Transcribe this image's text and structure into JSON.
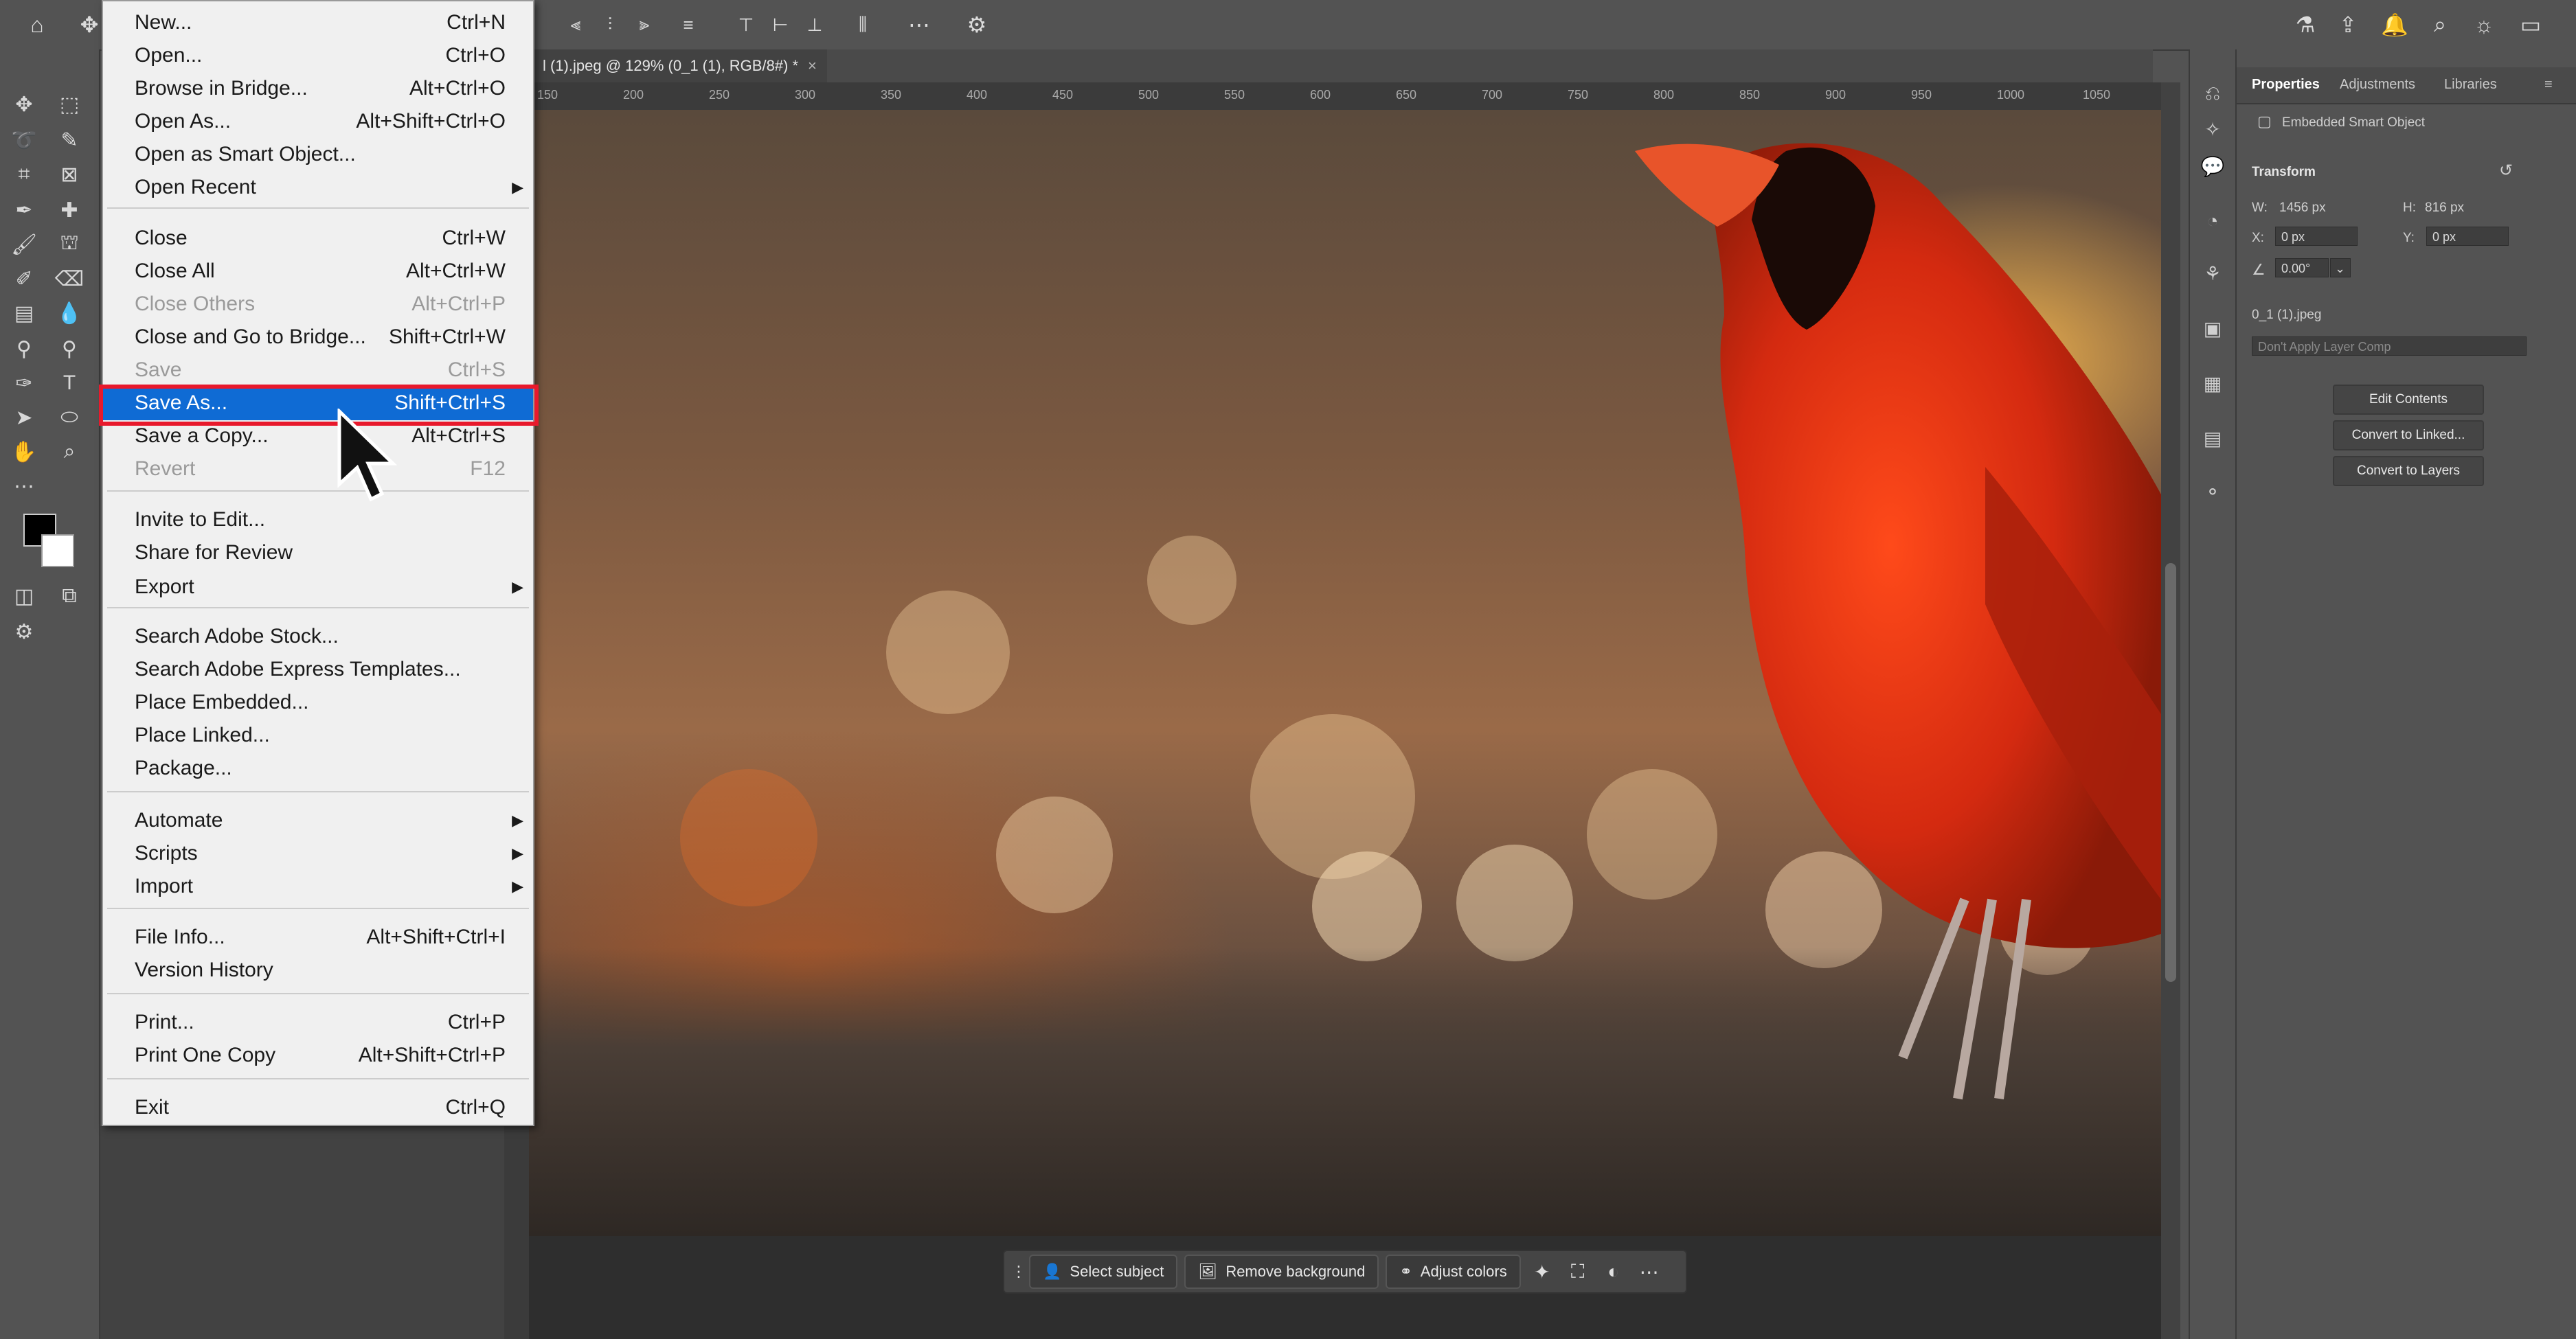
{
  "document_tab": {
    "title": "l (1).jpeg @ 129% (0_1 (1), RGB/8#) *",
    "close": "×"
  },
  "ruler_ticks": [
    "150",
    "200",
    "250",
    "300",
    "350",
    "400",
    "450",
    "500",
    "550",
    "600",
    "650",
    "700",
    "750",
    "800",
    "850",
    "900",
    "950",
    "1000",
    "1050"
  ],
  "file_menu": {
    "items": [
      {
        "label": "New...",
        "shortcut": "Ctrl+N"
      },
      {
        "label": "Open...",
        "shortcut": "Ctrl+O"
      },
      {
        "label": "Browse in Bridge...",
        "shortcut": "Alt+Ctrl+O"
      },
      {
        "label": "Open As...",
        "shortcut": "Alt+Shift+Ctrl+O"
      },
      {
        "label": "Open as Smart Object...",
        "shortcut": ""
      },
      {
        "label": "Open Recent",
        "shortcut": "",
        "submenu": true
      },
      {
        "label": "Close",
        "shortcut": "Ctrl+W"
      },
      {
        "label": "Close All",
        "shortcut": "Alt+Ctrl+W"
      },
      {
        "label": "Close Others",
        "shortcut": "Alt+Ctrl+P",
        "disabled": true
      },
      {
        "label": "Close and Go to Bridge...",
        "shortcut": "Shift+Ctrl+W"
      },
      {
        "label": "Save",
        "shortcut": "Ctrl+S",
        "disabled": true
      },
      {
        "label": "Save As...",
        "shortcut": "Shift+Ctrl+S",
        "highlighted": true
      },
      {
        "label": "Save a Copy...",
        "shortcut": "Alt+Ctrl+S"
      },
      {
        "label": "Revert",
        "shortcut": "F12",
        "disabled": true
      },
      {
        "label": "Invite to Edit...",
        "shortcut": ""
      },
      {
        "label": "Share for Review",
        "shortcut": ""
      },
      {
        "label": "Export",
        "shortcut": "",
        "submenu": true
      },
      {
        "label": "Search Adobe Stock...",
        "shortcut": ""
      },
      {
        "label": "Search Adobe Express Templates...",
        "shortcut": ""
      },
      {
        "label": "Place Embedded...",
        "shortcut": ""
      },
      {
        "label": "Place Linked...",
        "shortcut": ""
      },
      {
        "label": "Package...",
        "shortcut": ""
      },
      {
        "label": "Automate",
        "shortcut": "",
        "submenu": true
      },
      {
        "label": "Scripts",
        "shortcut": "",
        "submenu": true
      },
      {
        "label": "Import",
        "shortcut": "",
        "submenu": true
      },
      {
        "label": "File Info...",
        "shortcut": "Alt+Shift+Ctrl+I"
      },
      {
        "label": "Version History",
        "shortcut": ""
      },
      {
        "label": "Print...",
        "shortcut": "Ctrl+P"
      },
      {
        "label": "Print One Copy",
        "shortcut": "Alt+Shift+Ctrl+P"
      },
      {
        "label": "Exit",
        "shortcut": "Ctrl+Q"
      }
    ]
  },
  "context_bar": {
    "select_subject": "Select subject",
    "remove_background": "Remove background",
    "adjust_colors": "Adjust colors"
  },
  "properties": {
    "tabs": [
      "Properties",
      "Adjustments",
      "Libraries"
    ],
    "layer_type": "Embedded Smart Object",
    "section": "Transform",
    "w_label": "W:",
    "w_value": "1456 px",
    "h_label": "H:",
    "h_value": "816 px",
    "x_label": "X:",
    "x_value": "0 px",
    "y_label": "Y:",
    "y_value": "0 px",
    "angle_value": "0.00°",
    "filename": "0_1 (1).jpeg",
    "layer_comp": "Don't Apply Layer Comp",
    "buttons": [
      "Edit Contents",
      "Convert to Linked...",
      "Convert to Layers"
    ]
  },
  "colors": {
    "menu_highlight": "#0f6bd4",
    "annotation_box": "#e8192c",
    "ui_bg": "#535353"
  }
}
